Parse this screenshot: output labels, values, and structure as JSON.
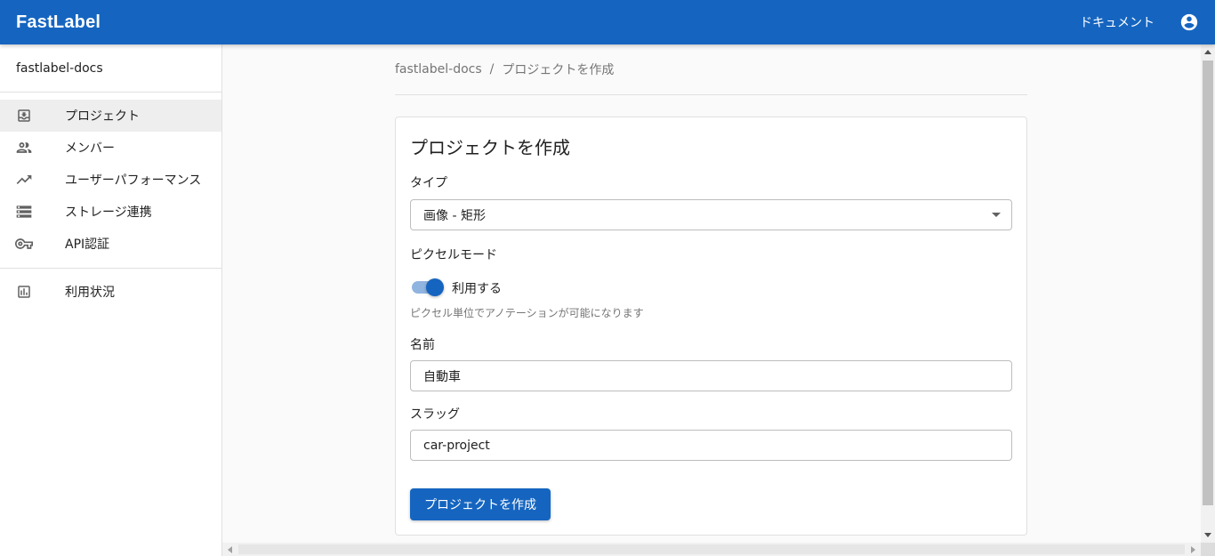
{
  "appbar": {
    "brand": "FastLabel",
    "docs_link": "ドキュメント",
    "account_icon": "account-circle-icon",
    "color": "#1565c0"
  },
  "sidebar": {
    "workspace": "fastlabel-docs",
    "items": [
      {
        "label": "プロジェクト",
        "icon": "download-box-icon",
        "active": true
      },
      {
        "label": "メンバー",
        "icon": "people-icon",
        "active": false
      },
      {
        "label": "ユーザーパフォーマンス",
        "icon": "trending-up-icon",
        "active": false
      },
      {
        "label": "ストレージ連携",
        "icon": "storage-icon",
        "active": false
      },
      {
        "label": "API認証",
        "icon": "key-icon",
        "active": false
      }
    ],
    "secondary_items": [
      {
        "label": "利用状況",
        "icon": "bar-chart-icon",
        "active": false
      }
    ]
  },
  "breadcrumb": {
    "items": [
      "fastlabel-docs",
      "プロジェクトを作成"
    ],
    "separator": "/"
  },
  "form": {
    "title": "プロジェクトを作成",
    "type_label": "タイプ",
    "type_value": "画像 - 矩形",
    "pixel_mode_label": "ピクセルモード",
    "pixel_mode_switch_label": "利用する",
    "pixel_mode_enabled": true,
    "pixel_mode_helper": "ピクセル単位でアノテーションが可能になります",
    "name_label": "名前",
    "name_value": "自動車",
    "slug_label": "スラッグ",
    "slug_value": "car-project",
    "submit_label": "プロジェクトを作成"
  }
}
